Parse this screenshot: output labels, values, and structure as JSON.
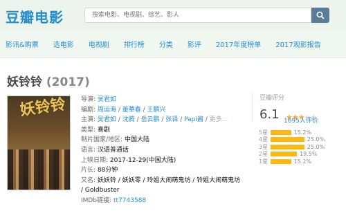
{
  "header": {
    "logo": "豆瓣电影",
    "search_placeholder": "搜索电影、电视剧、综艺、影人"
  },
  "nav": {
    "items": [
      "影讯&购票",
      "选电影",
      "电视剧",
      "排行榜",
      "分类",
      "影评",
      "2017年度榜单",
      "2017观影报告"
    ]
  },
  "movie": {
    "title": "妖铃铃",
    "year": "(2017)",
    "poster_text": "妖铃铃",
    "info": {
      "director_label": "导演:",
      "director": "吴君如",
      "writer_label": "编剧:",
      "writers": [
        "周运海",
        "董華春",
        "王鹏兴"
      ],
      "cast_label": "主演:",
      "cast": [
        "吴君如",
        "沈腾",
        "岳云鹏",
        "张译",
        "Papi酱"
      ],
      "cast_more": "更多...",
      "genre_label": "类型:",
      "genre": "喜剧",
      "region_label": "制片国家/地区:",
      "region": "中国大陆",
      "language_label": "语言:",
      "language": "汉语普通话",
      "release_label": "上映日期:",
      "release": "2017-12-29(中国大陆)",
      "runtime_label": "片长:",
      "runtime": "88分钟",
      "aka_label": "又名:",
      "aka_line1": "妖妖铃 / 妖妖零 / 玲姐大闹萌鬼坊 / 铃姐大闹萌鬼坊",
      "aka_line2": "/ Goldbuster",
      "imdb_label": "IMDb链接:",
      "imdb": "tt7743588"
    }
  },
  "rating": {
    "label": "豆瓣评分",
    "score": "6.1",
    "stars": 3,
    "votes": "1695人评价",
    "distribution": [
      {
        "star": "5星",
        "pct": "15.2%",
        "value": 15.2
      },
      {
        "star": "4星",
        "pct": "25.0%",
        "value": 25.0
      },
      {
        "star": "3星",
        "pct": "25.0%",
        "value": 25.0
      },
      {
        "star": "2星",
        "pct": "19.5%",
        "value": 19.5
      },
      {
        "star": "1星",
        "pct": "15.2%",
        "value": 15.2
      }
    ]
  },
  "colors": {
    "link": "#268dcd",
    "header_bg": "#edf4ed",
    "star": "#ffac2d",
    "bar": "#ffb712"
  }
}
